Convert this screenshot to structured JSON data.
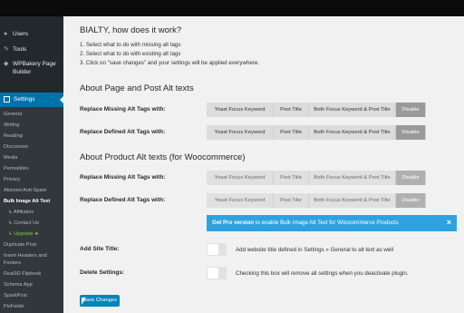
{
  "sidebar": {
    "top_items": [
      {
        "label": "Users",
        "icon": "users-icon"
      },
      {
        "label": "Tools",
        "icon": "tools-icon"
      },
      {
        "label": "WPBakery Page",
        "icon": "wpbakery-icon"
      },
      {
        "label": "Builder",
        "icon": ""
      }
    ],
    "settings_label": "Settings",
    "submenu": [
      "General",
      "Writing",
      "Reading",
      "Discussion",
      "Media",
      "Permalinks",
      "Privacy",
      "Akismet Anti-Spam",
      "Bulk Image Alt Text",
      "↳ Affiliation",
      "↳ Contact Us",
      "↳ Upgrade ►",
      "Duplicate Post",
      "Insert Headers and",
      "Footers",
      "Real3D Flipbook",
      "Schema App",
      "SparkPost",
      "PixFields"
    ]
  },
  "main": {
    "intro_title": "BIALTY, how does it work?",
    "steps": [
      "1. Select what to do with missing alt tags",
      "2. Select what to do with existing alt tags",
      "3. Click on \"save changes\" and your settings will be applied everywhere."
    ],
    "section1_title": "About Page and Post Alt texts",
    "section2_title": "About Product Alt texts (for Woocommerce)",
    "replace_missing_label": "Replace Missing Alt Tags with:",
    "replace_defined_label": "Replace Defined Alt Tags with:",
    "options": [
      "Yoast Focus Keyword",
      "Post Title",
      "Both Focus Keyword & Post Title",
      "Disable"
    ],
    "notice": {
      "strong": "Get Pro version",
      "text": " to enable Bulk Image Alt Text for Woocommerce Products",
      "close": "×"
    },
    "add_site_title_label": "Add Site Title:",
    "add_site_title_desc": "Add website title defined in Settings » General to alt text as well",
    "delete_settings_label": "Delete Settings:",
    "delete_settings_desc": "Checking this box will remove all settings when you deactivate plugin.",
    "save_button": "Save Changes"
  }
}
